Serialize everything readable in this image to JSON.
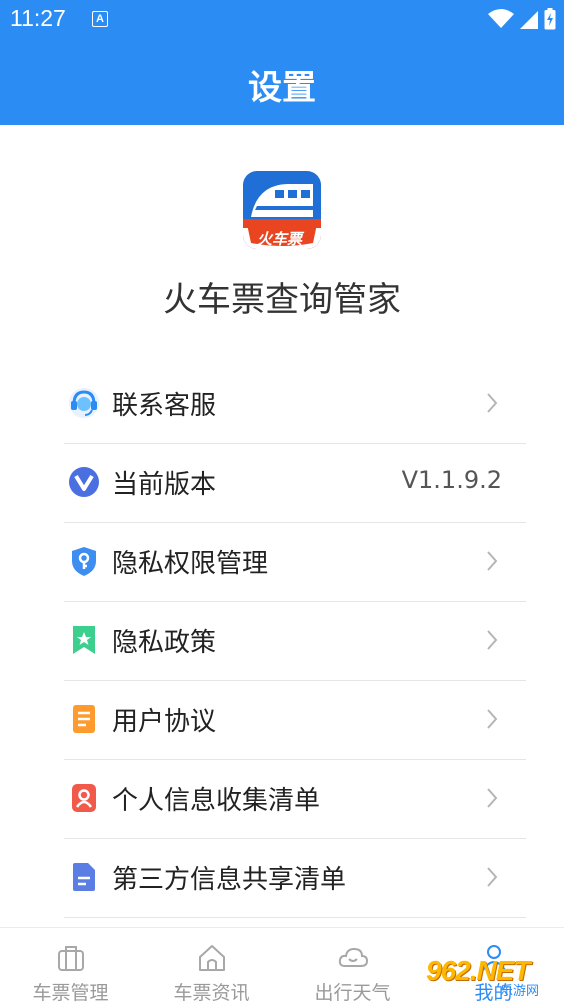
{
  "status_bar": {
    "time": "11:27",
    "badge": "A"
  },
  "header": {
    "title": "设置"
  },
  "app": {
    "logo_text": "火车票",
    "name": "火车票查询管家"
  },
  "menu": [
    {
      "label": "联系客服",
      "icon": "headset-icon"
    },
    {
      "label": "当前版本",
      "icon": "version-icon",
      "value": "V1.1.9.2"
    },
    {
      "label": "隐私权限管理",
      "icon": "shield-key-icon"
    },
    {
      "label": "隐私政策",
      "icon": "bookmark-star-icon"
    },
    {
      "label": "用户协议",
      "icon": "document-icon"
    },
    {
      "label": "个人信息收集清单",
      "icon": "person-card-icon"
    },
    {
      "label": "第三方信息共享清单",
      "icon": "file-icon"
    }
  ],
  "tabs": [
    {
      "label": "车票管理",
      "icon": "suitcase-icon"
    },
    {
      "label": "车票资讯",
      "icon": "home-icon"
    },
    {
      "label": "出行天气",
      "icon": "weather-icon"
    },
    {
      "label": "我的",
      "icon": "user-icon"
    }
  ],
  "watermark": {
    "brand": "962.NET",
    "sub": "乐游网"
  },
  "colors": {
    "primary": "#2b8cf4",
    "text": "#222222",
    "muted": "#9a9a9a"
  }
}
